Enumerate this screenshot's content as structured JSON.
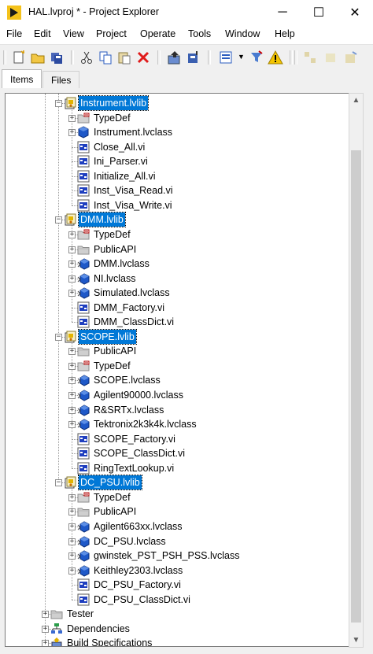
{
  "window": {
    "title": "HAL.lvproj * - Project Explorer",
    "minimize_glyph": "─",
    "maximize_glyph": "☐",
    "close_glyph": "✕"
  },
  "menu": [
    "File",
    "Edit",
    "View",
    "Project",
    "Operate",
    "Tools",
    "Window",
    "Help"
  ],
  "tabs": [
    {
      "label": "Items",
      "active": true
    },
    {
      "label": "Files",
      "active": false
    }
  ],
  "tree": [
    {
      "label": "Instrument.lvlib",
      "icon": "library-icon",
      "level": 0,
      "expanded": true,
      "selected": true
    },
    {
      "label": "TypeDef",
      "icon": "folder-typedef-icon",
      "level": 1,
      "collapsed": true
    },
    {
      "label": "Instrument.lvclass",
      "icon": "class-icon",
      "level": 1,
      "collapsed": true
    },
    {
      "label": "Close_All.vi",
      "icon": "vi-icon",
      "level": 1
    },
    {
      "label": "Ini_Parser.vi",
      "icon": "vi-icon",
      "level": 1
    },
    {
      "label": "Initialize_All.vi",
      "icon": "vi-icon",
      "level": 1
    },
    {
      "label": "Inst_Visa_Read.vi",
      "icon": "vi-icon",
      "level": 1
    },
    {
      "label": "Inst_Visa_Write.vi",
      "icon": "vi-icon",
      "level": 1
    },
    {
      "label": "DMM.lvlib",
      "icon": "library-icon",
      "level": 0,
      "expanded": true,
      "selected": true
    },
    {
      "label": "TypeDef",
      "icon": "folder-typedef-icon",
      "level": 1,
      "collapsed": true
    },
    {
      "label": "PublicAPI",
      "icon": "folder-icon",
      "level": 1,
      "collapsed": true
    },
    {
      "label": "DMM.lvclass",
      "icon": "class-child-icon",
      "level": 1,
      "collapsed": true
    },
    {
      "label": "NI.lvclass",
      "icon": "class-child-icon",
      "level": 1,
      "collapsed": true
    },
    {
      "label": "Simulated.lvclass",
      "icon": "class-child-icon",
      "level": 1,
      "collapsed": true
    },
    {
      "label": "DMM_Factory.vi",
      "icon": "vi-icon",
      "level": 1
    },
    {
      "label": "DMM_ClassDict.vi",
      "icon": "vi-icon",
      "level": 1
    },
    {
      "label": "SCOPE.lvlib",
      "icon": "library-icon",
      "level": 0,
      "expanded": true,
      "selected": true
    },
    {
      "label": "PublicAPI",
      "icon": "folder-icon",
      "level": 1,
      "collapsed": true
    },
    {
      "label": "TypeDef",
      "icon": "folder-typedef-icon",
      "level": 1,
      "collapsed": true
    },
    {
      "label": "SCOPE.lvclass",
      "icon": "class-child-icon",
      "level": 1,
      "collapsed": true
    },
    {
      "label": "Agilent90000.lvclass",
      "icon": "class-child-icon",
      "level": 1,
      "collapsed": true
    },
    {
      "label": "R&SRTx.lvclass",
      "icon": "class-child-icon",
      "level": 1,
      "collapsed": true
    },
    {
      "label": "Tektronix2k3k4k.lvclass",
      "icon": "class-child-icon",
      "level": 1,
      "collapsed": true
    },
    {
      "label": "SCOPE_Factory.vi",
      "icon": "vi-icon",
      "level": 1
    },
    {
      "label": "SCOPE_ClassDict.vi",
      "icon": "vi-icon",
      "level": 1
    },
    {
      "label": "RingTextLookup.vi",
      "icon": "vi-icon",
      "level": 1
    },
    {
      "label": "DC_PSU.lvlib",
      "icon": "library-icon",
      "level": 0,
      "expanded": true,
      "selected": true
    },
    {
      "label": "TypeDef",
      "icon": "folder-typedef-icon",
      "level": 1,
      "collapsed": true
    },
    {
      "label": "PublicAPI",
      "icon": "folder-icon",
      "level": 1,
      "collapsed": true
    },
    {
      "label": "Agilent663xx.lvclass",
      "icon": "class-child-icon",
      "level": 1,
      "collapsed": true
    },
    {
      "label": "DC_PSU.lvclass",
      "icon": "class-child-icon",
      "level": 1,
      "collapsed": true
    },
    {
      "label": "gwinstek_PST_PSH_PSS.lvclass",
      "icon": "class-child-icon",
      "level": 1,
      "collapsed": true
    },
    {
      "label": "Keithley2303.lvclass",
      "icon": "class-child-icon",
      "level": 1,
      "collapsed": true
    },
    {
      "label": "DC_PSU_Factory.vi",
      "icon": "vi-icon",
      "level": 1
    },
    {
      "label": "DC_PSU_ClassDict.vi",
      "icon": "vi-icon",
      "level": 1
    },
    {
      "label": "Tester",
      "icon": "folder-icon",
      "level": -1,
      "collapsed": true
    },
    {
      "label": "Dependencies",
      "icon": "dependencies-icon",
      "level": -1,
      "collapsed": true
    },
    {
      "label": "Build Specifications",
      "icon": "build-icon",
      "level": -1,
      "collapsed": true
    }
  ],
  "colors": {
    "selection": "#0078d7",
    "vi_blue": "#1f3fbf",
    "class_blue": "#1e58c8",
    "folder": "#c9c9c9"
  }
}
